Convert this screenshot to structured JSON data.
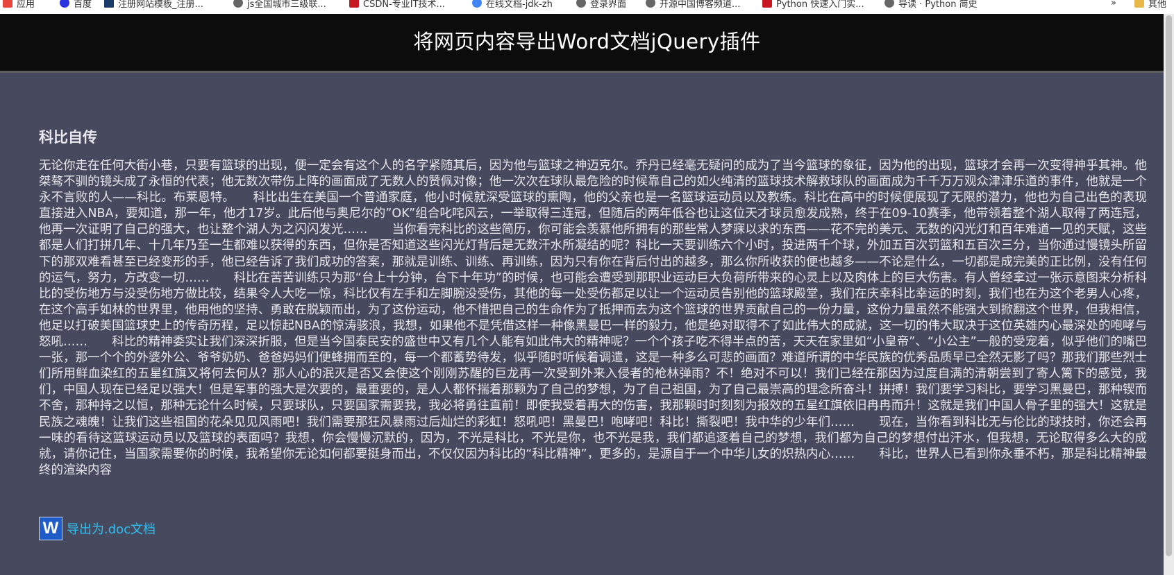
{
  "bookmarks": [
    {
      "label": "应用",
      "icon": "apps-grid-icon",
      "color": "#e8453c"
    },
    {
      "label": "百度",
      "icon": "baidu-paw-icon",
      "color": "#2932e1"
    },
    {
      "label": "注册网站模板_注册...",
      "icon": "site-favicon-icon",
      "color": "#1a3a6a"
    },
    {
      "label": "js全国城市三级联...",
      "icon": "globe-icon",
      "color": "#666666"
    },
    {
      "label": "CSDN-专业IT技术...",
      "icon": "csdn-icon",
      "color": "#c81623"
    },
    {
      "label": "在线文档-jdk-zh",
      "icon": "chrome-icon",
      "color": "#4285f4"
    },
    {
      "label": "登录界面",
      "icon": "globe-icon",
      "color": "#666666"
    },
    {
      "label": "开源中国博客频道...",
      "icon": "globe-icon",
      "color": "#666666"
    },
    {
      "label": "Python 快速入门实...",
      "icon": "csdn-icon",
      "color": "#c81623"
    },
    {
      "label": "导读 · Python 简史",
      "icon": "globe-icon",
      "color": "#666666"
    },
    {
      "label": "»",
      "icon": "",
      "color": "#666666"
    },
    {
      "label": "其他",
      "icon": "folder-icon",
      "color": "#e8b84a"
    }
  ],
  "header": {
    "title": "将网页内容导出Word文档jQuery插件"
  },
  "article": {
    "title": "科比自传",
    "body": "无论你走在任何大街小巷，只要有篮球的出现，便一定会有这个人的名字紧随其后，因为他与篮球之神迈克尔。乔丹已经毫无疑问的成为了当今篮球的象征，因为他的出现，篮球才会再一次变得神乎其神。他桀骜不驯的镜头成了永恒的代表；他无数次带伤上阵的画面成了无数人的赞佩对像；他一次次在球队最危险的时候靠自己的如火纯清的篮球技术解救球队的画面成为千千万万观众津津乐道的事件，他就是一个永不言败的人——科比。布莱恩特。　　科比出生在美国一个普通家庭，他小时候就深受篮球的熏陶，他的父亲也是一名篮球运动员以及教练。科比在高中的时候便展现了无限的潜力，他也为自己出色的表现直接进入NBA，要知道，那一年，他才17岁。此后他与奥尼尔的”OK”组合叱咤风云，一举取得三连冠，但随后的两年低谷也让这位天才球员愈发成熟，终于在09-10赛季，他带领着整个湖人取得了两连冠，他再一次证明了自己的强大，也让整个湖人为之闪闪发光……　　当你看完科比的这些简历，你可能会羡慕他所拥有的那些常人梦寐以求的东西——花不完的美元、无数的闪光灯和百年难道一见的天赋，这些都是人们打拼几年、十几年乃至一生都难以获得的东西，但你是否知道这些闪光灯背后是无数汗水所凝结的呢？科比一天要训练六个小时，投进两千个球，外加五百次罚篮和五百次三分，当你通过慢镜头所留下的那双难看甚至已经变形的手，他已经告诉了我们成功的答案，那就是训练、训练、再训练，因为只有你在背后付出的越多，那么你所收获的便也越多——不论是什么，一切都是成完美的正比例，没有任何的运气，努力，方改变一切……　　科比在苦苦训练只为那“台上十分钟，台下十年功”的时候，也可能会遭受到那职业运动巨大负荷所带来的心灵上以及肉体上的巨大伤害。有人曾经拿过一张示意图来分析科比的受伤地方与没受伤地方做比较，结果令人大吃一惊，科比仅有左手和左脚腕没受伤，其他的每一处受伤都足以让一个运动员告别他的篮球殿堂，我们在庆幸科比幸运的时刻，我们也在为这个老男人心疼，在这个高手如林的世界里，他用他的坚持、勇敢在脱颖而出，为了这份运动，他不惜把自己的生命作为了抵押而去为这个篮球的世界贡献自己的一份力量，这份力量虽然不能强大到掀翻这个世界，但我相信，他足以打破美国篮球史上的传奇历程，足以惊起NBA的惊涛骇浪，我想，如果他不是凭借这样一种像黑曼巴一样的毅力，他是绝对取得不了如此伟大的成就，这一切的伟大取决于这位英雄内心最深处的咆哮与怒吼……　　科比的精神委实让我们深深折服，但是当今国泰民安的盛世中又有几个人能有如此伟大的精神呢？一个个孩子吃不得半点的苦，天天在家里如“小皇帝”、“小公主”一般的受宠着，似乎他们的嘴巴一张，那一个个的外婆外公、爷爷奶奶、爸爸妈妈们便蜂拥而至的，每一个都蓄势待发，似乎随时听候着调遣，这是一种多么可悲的画面？难道所谓的中华民族的优秀品质早已全然无影了吗？那我们那些烈士们所用鲜血染红的五星红旗又将何去何从？那人心的泯灭是否又会使这个刚刚苏醒的巨龙再一次受到外来入侵者的枪林弹雨？不！绝对不可以！我们已经在那因为过度自满的清朝尝到了寄人篱下的感觉，我们，中国人现在已经足以强大！但是军事的强大是次要的，最重要的，是人人都怀揣着那颗为了自己的梦想，为了自己祖国，为了自己最崇高的理念所奋斗！拼搏！我们要学习科比，要学习黑曼巴，那种锲而不舍，那种持之以恒，那种无论什么时候，只要球队，只要国家需要我，我必将勇往直前！即使我受着再大的伤害，我那颗时时刻刻为报效的五星红旗依旧冉冉而升！这就是我们中国人骨子里的强大！这就是民族之魂魄！让我们这些祖国的花朵见见风雨吧！我们需要那狂风暴雨过后灿烂的彩虹！怒吼吧！黑曼巴！咆哮吧！科比！撕裂吧！我中华的少年们……　　现在，当你看到科比无与伦比的球技时，你还会再一味的看待这篮球运动员以及篮球的表面吗？我想，你会慢慢沉默的，因为，不光是科比，不光是你，也不光是我，我们都追逐着自己的梦想，我们都为自己的梦想付出汗水，但我想，无论取得多么大的成就，请你记住，当国家需要你的时候，我希望你无论如何都要挺身而出，不仅仅因为科比的“科比精神”，更多的，是源自于一个中华儿女的炽热内心……　　科比，世界人已看到你永垂不朽，那是科比精神最终的渲染内容"
  },
  "export": {
    "icon_letter": "W",
    "label": "导出为.doc文档"
  }
}
